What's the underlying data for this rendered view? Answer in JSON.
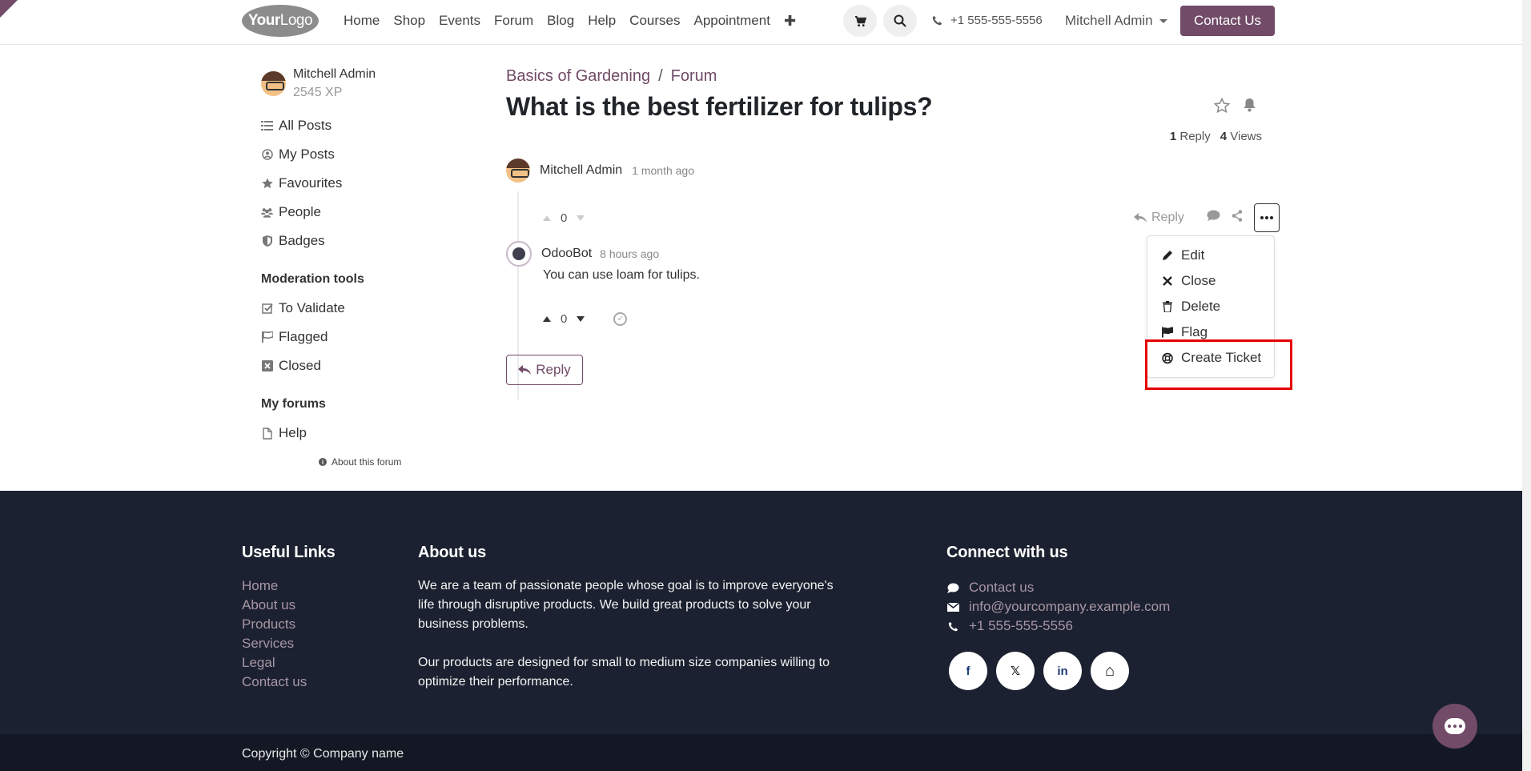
{
  "header": {
    "logo_text_bold": "Your",
    "logo_text_light": "Logo",
    "nav": [
      "Home",
      "Shop",
      "Events",
      "Forum",
      "Blog",
      "Help",
      "Courses",
      "Appointment"
    ],
    "plus": "✚",
    "phone": "+1 555-555-5556",
    "user": "Mitchell Admin",
    "contact_label": "Contact Us"
  },
  "sidebar": {
    "user_name": "Mitchell Admin",
    "user_xp": "2545 XP",
    "items": [
      {
        "label": "All Posts",
        "icon": "list-icon"
      },
      {
        "label": "My Posts",
        "icon": "user-circle-icon"
      },
      {
        "label": "Favourites",
        "icon": "star-icon"
      },
      {
        "label": "People",
        "icon": "users-icon"
      },
      {
        "label": "Badges",
        "icon": "shield-icon"
      }
    ],
    "moderation_title": "Moderation tools",
    "moderation": [
      {
        "label": "To Validate",
        "icon": "check-square-icon"
      },
      {
        "label": "Flagged",
        "icon": "flag-icon"
      },
      {
        "label": "Closed",
        "icon": "x-square-icon"
      }
    ],
    "forums_title": "My forums",
    "forums": [
      {
        "label": "Help",
        "icon": "file-icon"
      }
    ],
    "about_forum": "About this forum"
  },
  "post": {
    "breadcrumb": [
      "Basics of Gardening",
      "Forum"
    ],
    "breadcrumb_sep": "/",
    "title": "What is the best fertilizer for tulips?",
    "replies_count": "1",
    "replies_label": "Reply",
    "views_count": "4",
    "views_label": "Views",
    "author": "Mitchell Admin",
    "time": "1 month ago",
    "votes": "0",
    "reply_action": "Reply"
  },
  "dropdown": {
    "items": [
      {
        "label": "Edit",
        "icon": "pencil-icon"
      },
      {
        "label": "Close",
        "icon": "close-icon"
      },
      {
        "label": "Delete",
        "icon": "trash-icon"
      },
      {
        "label": "Flag",
        "icon": "flag-icon"
      },
      {
        "label": "Create Ticket",
        "icon": "lifebuoy-icon"
      }
    ]
  },
  "comment": {
    "author": "OdooBot",
    "time": "8 hours ago",
    "body": "You can use loam for tulips.",
    "votes": "0"
  },
  "reply_button": "Reply",
  "footer": {
    "useful_title": "Useful Links",
    "useful_links": [
      "Home",
      "About us",
      "Products",
      "Services",
      "Legal",
      "Contact us"
    ],
    "about_title": "About us",
    "about_p1": "We are a team of passionate people whose goal is to improve everyone's life through disruptive products. We build great products to solve your business problems.",
    "about_p2": "Our products are designed for small to medium size companies willing to optimize their performance.",
    "connect_title": "Connect with us",
    "contacts": [
      {
        "label": "Contact us",
        "icon": "comment-icon"
      },
      {
        "label": "info@yourcompany.example.com",
        "icon": "envelope-icon"
      },
      {
        "label": "+1 555-555-5556",
        "icon": "phone-icon"
      }
    ],
    "socials": [
      {
        "glyph": "f",
        "icon": "facebook-icon"
      },
      {
        "glyph": "𝕏",
        "icon": "x-icon"
      },
      {
        "glyph": "in",
        "icon": "linkedin-icon"
      },
      {
        "glyph": "⌂",
        "icon": "home-icon"
      }
    ],
    "copyright": "Copyright © Company name"
  },
  "colors": {
    "brand": "#714b67",
    "footer": "#1b2130",
    "highlight": "#e60000"
  }
}
